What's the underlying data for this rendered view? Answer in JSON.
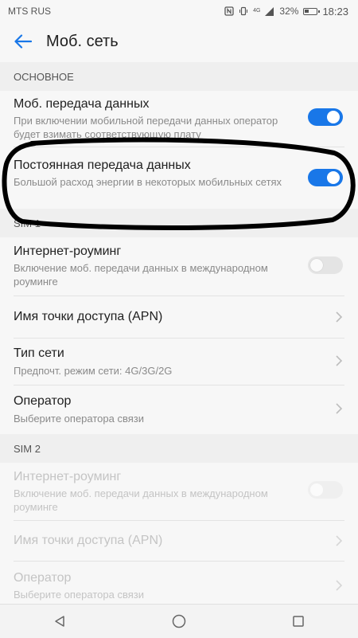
{
  "status_bar": {
    "carrier": "MTS RUS",
    "network_badge": "4G",
    "battery": "32%",
    "time": "18:23"
  },
  "header": {
    "title": "Моб. сеть",
    "back_icon": "arrow-left-icon"
  },
  "sections": {
    "basic": {
      "title": "ОСНОВНОЕ",
      "mobile_data": {
        "label": "Моб. передача данных",
        "sub": "При включении мобильной передачи данных оператор будет взимать соответствующую плату",
        "enabled": true
      },
      "always_on": {
        "label": "Постоянная передача данных",
        "sub": "Большой расход энергии в некоторых мобильных сетях",
        "enabled": true
      }
    },
    "sim1": {
      "title": "SIM 1",
      "roaming": {
        "label": "Интернет-роуминг",
        "sub": "Включение моб. передачи данных в международном роуминге",
        "enabled": false
      },
      "apn": {
        "label": "Имя точки доступа (APN)"
      },
      "network_type": {
        "label": "Тип сети",
        "sub": "Предпочт. режим сети: 4G/3G/2G"
      },
      "operator": {
        "label": "Оператор",
        "sub": "Выберите оператора связи"
      }
    },
    "sim2": {
      "title": "SIM 2",
      "roaming": {
        "label": "Интернет-роуминг",
        "sub": "Включение моб. передачи данных в международном роуминге",
        "enabled": false
      },
      "apn": {
        "label": "Имя точки доступа (APN)"
      },
      "operator": {
        "label": "Оператор",
        "sub": "Выберите оператора связи"
      }
    }
  },
  "nav": {
    "back": "triangle-back-icon",
    "home": "circle-home-icon",
    "recents": "square-recents-icon"
  },
  "colors": {
    "accent": "#1977e8",
    "annotation": "#000000"
  }
}
